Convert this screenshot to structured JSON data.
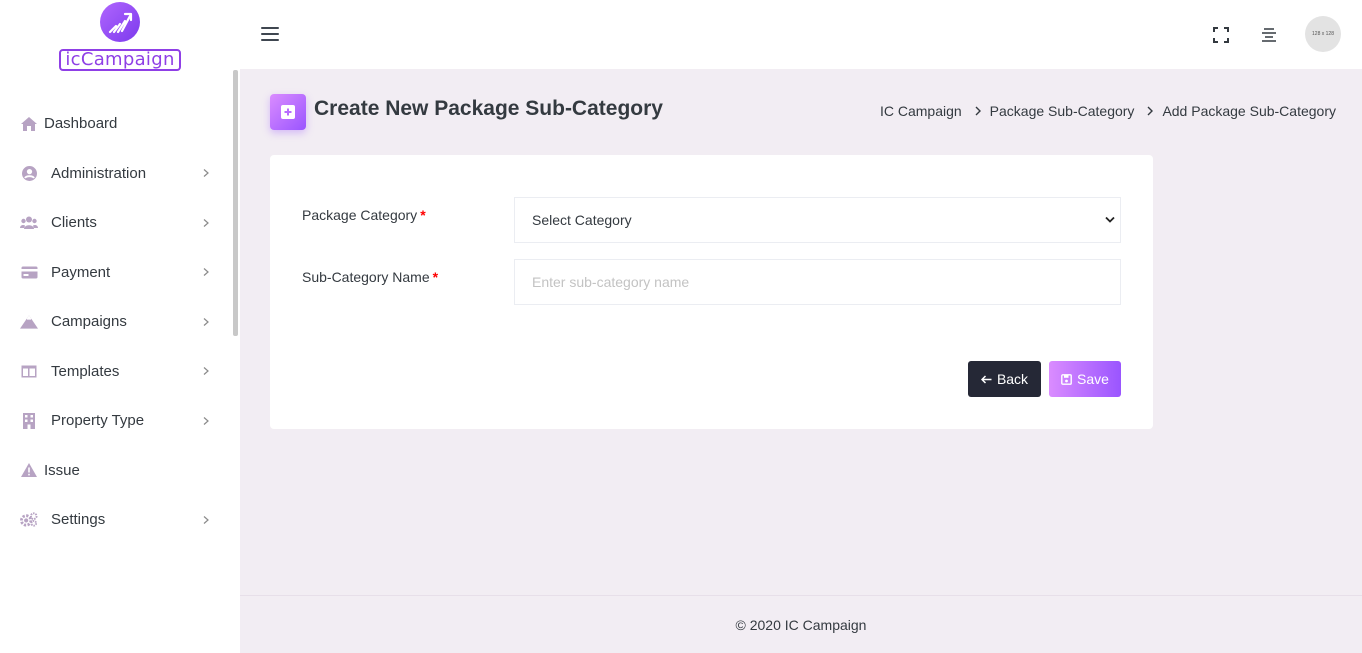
{
  "brand": {
    "logo_text": "icCampaign"
  },
  "sidebar": {
    "items": [
      {
        "label": "Dashboard",
        "icon": "home-icon"
      },
      {
        "label": "Administration",
        "icon": "user-circle-icon"
      },
      {
        "label": "Clients",
        "icon": "users-icon"
      },
      {
        "label": "Payment",
        "icon": "credit-card-icon"
      },
      {
        "label": "Campaigns",
        "icon": "mountain-icon"
      },
      {
        "label": "Templates",
        "icon": "layout-icon"
      },
      {
        "label": "Property Type",
        "icon": "building-icon"
      },
      {
        "label": "Issue",
        "icon": "warning-icon"
      },
      {
        "label": "Settings",
        "icon": "gears-icon"
      }
    ]
  },
  "header": {
    "avatar_text": "128 x 128"
  },
  "page": {
    "title": "Create New Package Sub-Category",
    "breadcrumb": [
      "IC Campaign",
      "Package Sub-Category",
      "Add Package Sub-Category"
    ]
  },
  "form": {
    "category_label": "Package Category",
    "category_value": "Select Category",
    "subcategory_label": "Sub-Category Name",
    "subcategory_placeholder": "Enter sub-category name",
    "required_mark": "*",
    "back_label": "Back",
    "save_label": "Save"
  },
  "footer": {
    "text": "© 2020 IC Campaign"
  },
  "colors": {
    "accent": "#9a55ff",
    "accent_light": "#da8cff",
    "dark_button": "#252836",
    "background": "#f2edf3",
    "sidebar_icon": "#b7a3c3",
    "required": "#fe0000"
  }
}
